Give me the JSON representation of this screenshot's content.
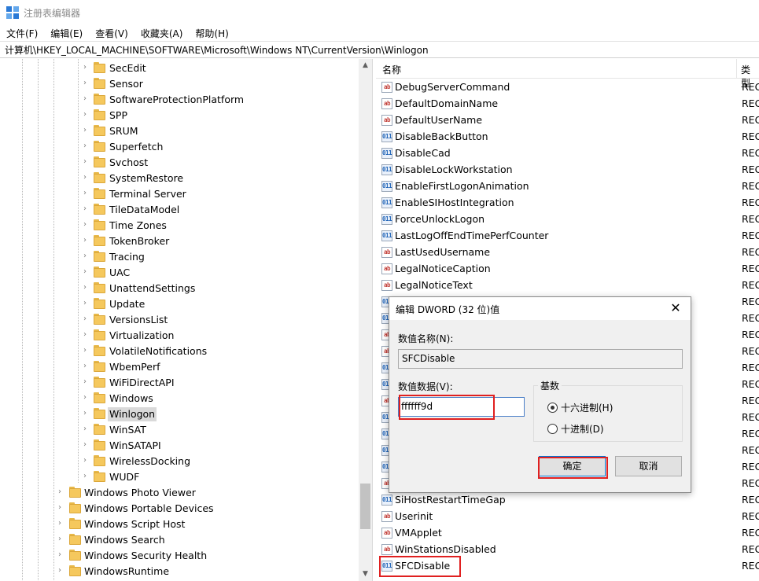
{
  "window": {
    "title": "注册表编辑器",
    "icon": "regedit-icon"
  },
  "menu": [
    "文件(F)",
    "编辑(E)",
    "查看(V)",
    "收藏夹(A)",
    "帮助(H)"
  ],
  "address": "计算机\\HKEY_LOCAL_MACHINE\\SOFTWARE\\Microsoft\\Windows NT\\CurrentVersion\\Winlogon",
  "tree": {
    "children": [
      "SecEdit",
      "Sensor",
      "SoftwareProtectionPlatform",
      "SPP",
      "SRUM",
      "Superfetch",
      "Svchost",
      "SystemRestore",
      "Terminal Server",
      "TileDataModel",
      "Time Zones",
      "TokenBroker",
      "Tracing",
      "UAC",
      "UnattendSettings",
      "Update",
      "VersionsList",
      "Virtualization",
      "VolatileNotifications",
      "WbemPerf",
      "WiFiDirectAPI",
      "Windows",
      "Winlogon",
      "WinSAT",
      "WinSATAPI",
      "WirelessDocking",
      "WUDF"
    ],
    "selected": "Winlogon",
    "siblings": [
      "Windows Photo Viewer",
      "Windows Portable Devices",
      "Windows Script Host",
      "Windows Search",
      "Windows Security Health",
      "WindowsRuntime"
    ]
  },
  "list": {
    "col_name": "名称",
    "col_type": "类型",
    "type_value": "REG",
    "rows": [
      {
        "name": "DebugServerCommand",
        "kind": "sz"
      },
      {
        "name": "DefaultDomainName",
        "kind": "sz"
      },
      {
        "name": "DefaultUserName",
        "kind": "sz"
      },
      {
        "name": "DisableBackButton",
        "kind": "dw"
      },
      {
        "name": "DisableCad",
        "kind": "dw"
      },
      {
        "name": "DisableLockWorkstation",
        "kind": "dw"
      },
      {
        "name": "EnableFirstLogonAnimation",
        "kind": "dw"
      },
      {
        "name": "EnableSIHostIntegration",
        "kind": "dw"
      },
      {
        "name": "ForceUnlockLogon",
        "kind": "dw"
      },
      {
        "name": "LastLogOffEndTimePerfCounter",
        "kind": "dw"
      },
      {
        "name": "LastUsedUsername",
        "kind": "sz"
      },
      {
        "name": "LegalNoticeCaption",
        "kind": "sz"
      },
      {
        "name": "LegalNoticeText",
        "kind": "sz"
      },
      {
        "name": "",
        "kind": "dw"
      },
      {
        "name": "",
        "kind": "dw"
      },
      {
        "name": "",
        "kind": "sz"
      },
      {
        "name": "",
        "kind": "sz"
      },
      {
        "name": "",
        "kind": "dw"
      },
      {
        "name": "",
        "kind": "dw"
      },
      {
        "name": "",
        "kind": "sz"
      },
      {
        "name": "",
        "kind": "dw"
      },
      {
        "name": "",
        "kind": "dw"
      },
      {
        "name": "",
        "kind": "dw"
      },
      {
        "name": "",
        "kind": "dw"
      },
      {
        "name": "",
        "kind": "sz"
      },
      {
        "name": "SiHostRestartTimeGap",
        "kind": "dw"
      },
      {
        "name": "Userinit",
        "kind": "sz"
      },
      {
        "name": "VMApplet",
        "kind": "sz"
      },
      {
        "name": "WinStationsDisabled",
        "kind": "sz"
      },
      {
        "name": "SFCDisable",
        "kind": "dw"
      }
    ]
  },
  "dialog": {
    "title": "编辑 DWORD (32 位)值",
    "close": "✕",
    "name_label": "数值名称(N):",
    "name_value": "SFCDisable",
    "data_label": "数值数据(V):",
    "data_value": "ffffff9d",
    "base_label": "基数",
    "hex_label": "十六进制(H)",
    "dec_label": "十进制(D)",
    "base_selected": "hex",
    "ok_label": "确定",
    "cancel_label": "取消"
  },
  "highlight_color": "#e02020"
}
